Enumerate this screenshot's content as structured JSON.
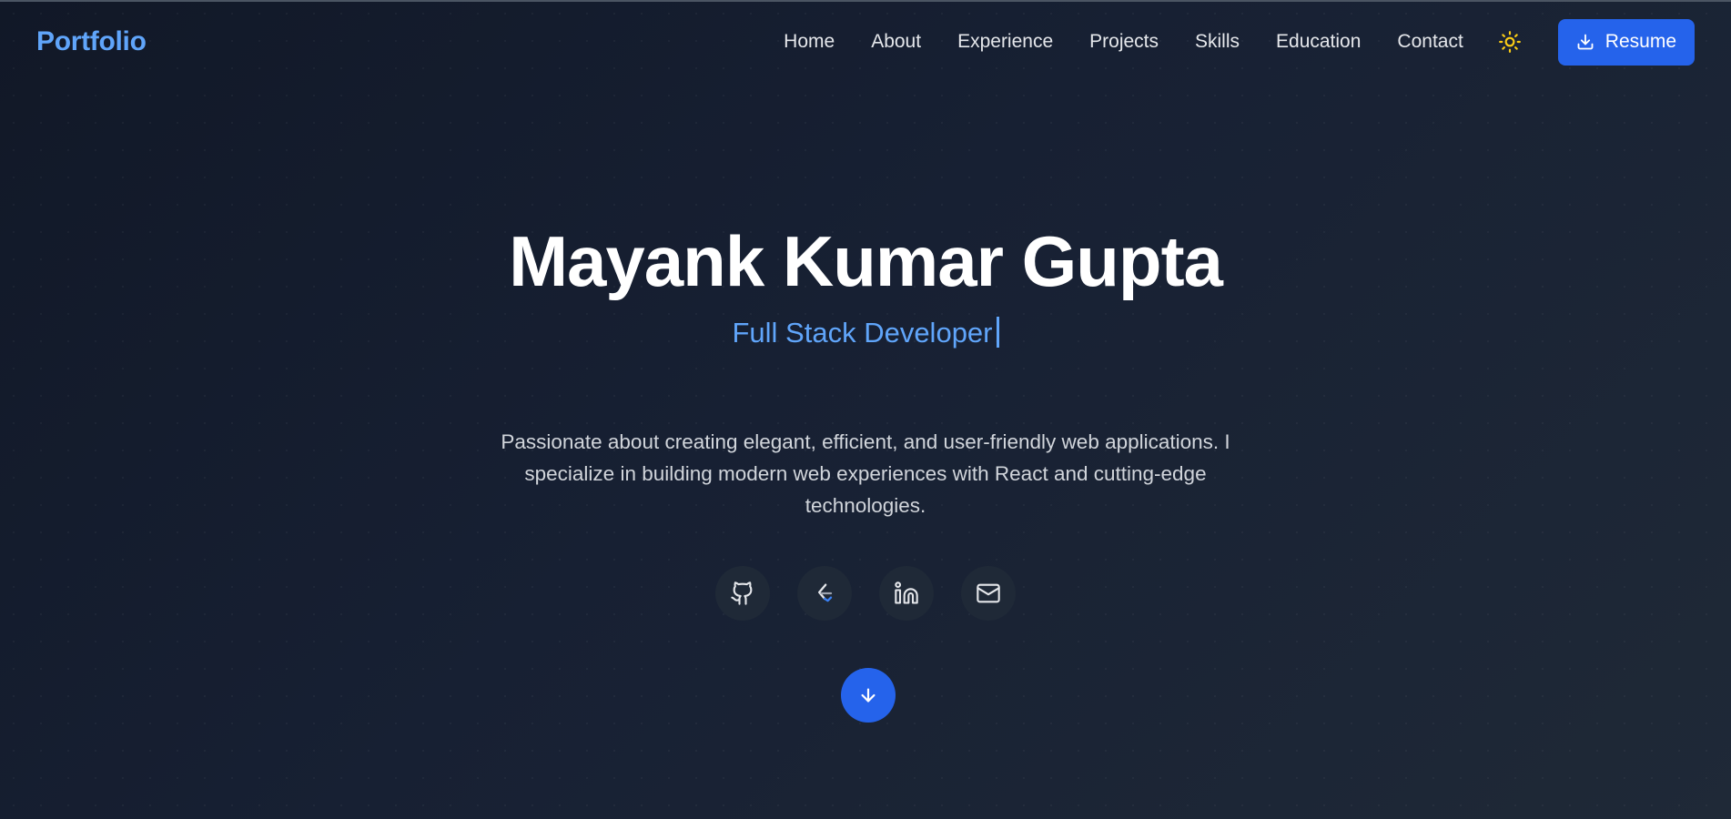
{
  "nav": {
    "brand": "Portfolio",
    "links": [
      "Home",
      "About",
      "Experience",
      "Projects",
      "Skills",
      "Education",
      "Contact"
    ],
    "theme_icon": "sun-icon",
    "resume_label": "Resume",
    "resume_icon": "download-icon"
  },
  "hero": {
    "name": "Mayank Kumar Gupta",
    "role": "Full Stack Developer",
    "description": "Passionate about creating elegant, efficient, and user-friendly web applications. I specialize in building modern web experiences with React and cutting-edge technologies.",
    "socials": [
      "github-icon",
      "leetcode-icon",
      "linkedin-icon",
      "mail-icon"
    ],
    "scroll_icon": "arrow-down-icon"
  },
  "colors": {
    "accent": "#2563eb",
    "brand": "#60a5fa",
    "sun": "#facc15",
    "background": "#111827"
  }
}
